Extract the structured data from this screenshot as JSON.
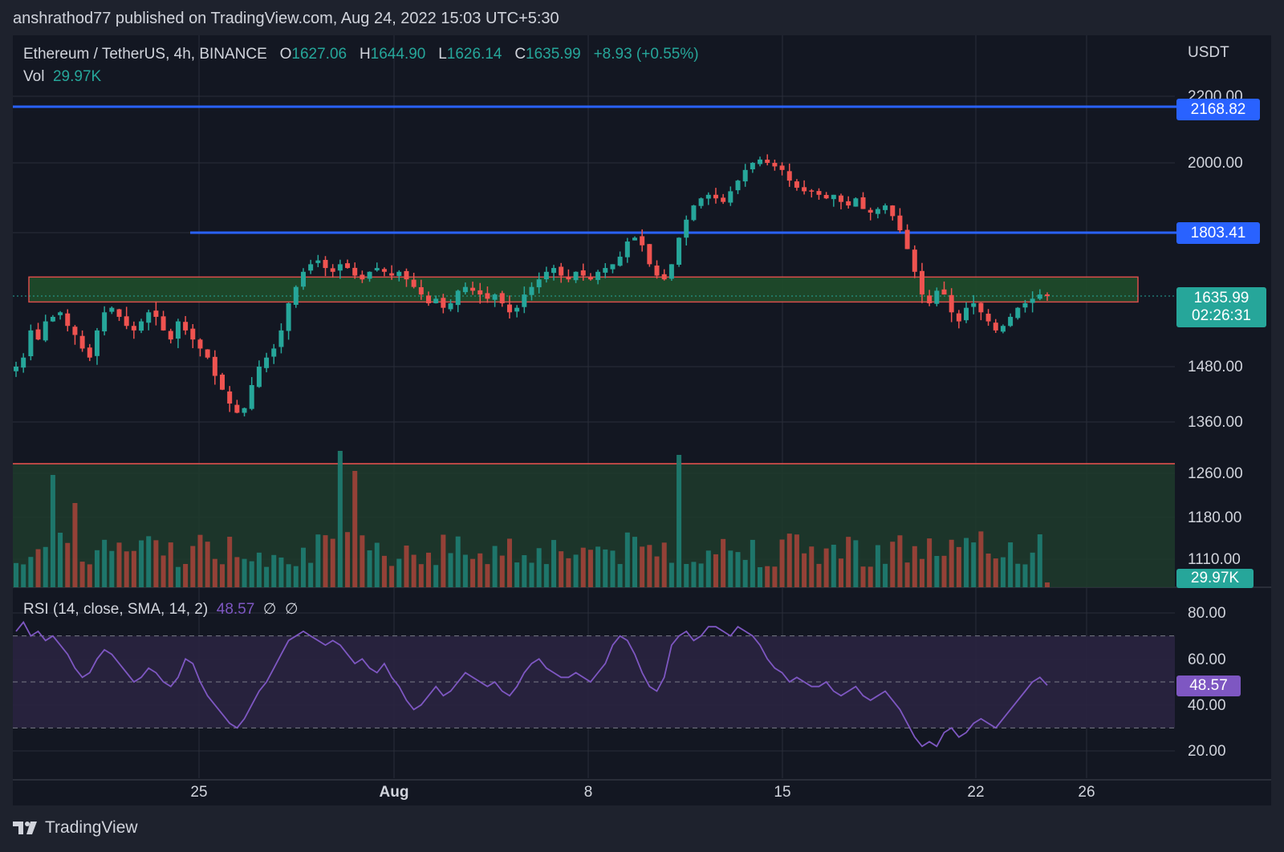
{
  "header": {
    "publish_line": "anshrathod77 published on TradingView.com, Aug 24, 2022 15:03 UTC+5:30"
  },
  "legend": {
    "symbol": "Ethereum / TetherUS, 4h, BINANCE",
    "o_label": "O",
    "o_value": "1627.06",
    "h_label": "H",
    "h_value": "1644.90",
    "l_label": "L",
    "l_value": "1626.14",
    "c_label": "C",
    "c_value": "1635.99",
    "change": "+8.93 (+0.55%)",
    "vol_label": "Vol",
    "vol_value": "29.97K"
  },
  "rsi_legend": {
    "label": "RSI (14, close, SMA, 14, 2)",
    "value": "48.57",
    "sym1": "∅",
    "sym2": "∅"
  },
  "price_axis": {
    "unit": "USDT",
    "ticks": [
      "2200.00",
      "2000.00",
      "1480.00",
      "1360.00",
      "1260.00",
      "1180.00",
      "1110.00"
    ]
  },
  "rsi_axis": {
    "ticks": [
      "80.00",
      "60.00",
      "40.00",
      "20.00"
    ]
  },
  "time_axis": {
    "ticks": [
      "25",
      "Aug",
      "8",
      "15",
      "22",
      "26"
    ]
  },
  "price_tags": {
    "resistance_high": "2168.82",
    "resistance_mid": "1803.41",
    "last_price": "1635.99",
    "countdown": "02:26:31",
    "volume": "29.97K",
    "rsi": "48.57"
  },
  "footer": {
    "brand": "TradingView"
  },
  "colors": {
    "up": "#26a69a",
    "down": "#ef5350",
    "line_blue": "#2962ff",
    "rsi_line": "#7e57c2",
    "background": "#131722"
  },
  "chart_data": {
    "type": "candlestick",
    "symbol": "ETH/USDT",
    "interval": "4h",
    "x_ticks": [
      "25",
      "Aug",
      "8",
      "15",
      "22",
      "26"
    ],
    "y_ticks": [
      2000,
      1480,
      1360,
      1260,
      1180,
      1110
    ],
    "horizontal_lines": [
      2168.82,
      1803.41
    ],
    "support_zone": [
      1630,
      1665
    ],
    "last_close": 1635.99,
    "close_series": [
      1480,
      1500,
      1560,
      1540,
      1580,
      1590,
      1600,
      1570,
      1550,
      1520,
      1500,
      1560,
      1600,
      1610,
      1590,
      1570,
      1560,
      1580,
      1600,
      1590,
      1560,
      1540,
      1580,
      1560,
      1540,
      1520,
      1500,
      1460,
      1430,
      1400,
      1380,
      1390,
      1440,
      1480,
      1500,
      1520,
      1560,
      1620,
      1660,
      1700,
      1720,
      1730,
      1710,
      1700,
      1720,
      1710,
      1690,
      1680,
      1700,
      1710,
      1700,
      1690,
      1700,
      1680,
      1660,
      1640,
      1620,
      1630,
      1610,
      1620,
      1650,
      1660,
      1650,
      1640,
      1630,
      1640,
      1620,
      1600,
      1610,
      1640,
      1660,
      1680,
      1700,
      1710,
      1690,
      1680,
      1700,
      1690,
      1680,
      1700,
      1710,
      1720,
      1740,
      1780,
      1790,
      1770,
      1720,
      1690,
      1680,
      1720,
      1790,
      1840,
      1880,
      1900,
      1910,
      1900,
      1890,
      1920,
      1950,
      1980,
      2000,
      2010,
      2000,
      1990,
      1980,
      1950,
      1930,
      1920,
      1920,
      1910,
      1900,
      1910,
      1890,
      1880,
      1900,
      1870,
      1860,
      1870,
      1880,
      1850,
      1810,
      1760,
      1700,
      1640,
      1620,
      1650,
      1640,
      1600,
      1580,
      1610,
      1620,
      1600,
      1580,
      1560,
      1570,
      1590,
      1610,
      1620,
      1630,
      1640,
      1636
    ],
    "volume_note": "relative volume bars, last 29.97K",
    "rsi": {
      "params": "RSI (14, close, SMA, 14, 2)",
      "last": 48.57,
      "bands": [
        30,
        50,
        70
      ],
      "y_ticks": [
        80,
        60,
        40,
        20
      ],
      "values": [
        72,
        76,
        70,
        72,
        68,
        70,
        66,
        62,
        56,
        52,
        54,
        60,
        64,
        62,
        58,
        54,
        50,
        52,
        56,
        54,
        50,
        48,
        52,
        60,
        58,
        50,
        44,
        40,
        36,
        32,
        30,
        34,
        40,
        46,
        50,
        56,
        62,
        68,
        70,
        72,
        70,
        68,
        66,
        68,
        66,
        62,
        58,
        60,
        56,
        54,
        58,
        52,
        48,
        42,
        38,
        40,
        44,
        48,
        44,
        46,
        50,
        54,
        52,
        50,
        48,
        50,
        46,
        44,
        48,
        54,
        58,
        60,
        56,
        54,
        52,
        52,
        54,
        52,
        50,
        54,
        58,
        66,
        70,
        68,
        62,
        54,
        48,
        46,
        52,
        66,
        70,
        72,
        68,
        70,
        74,
        74,
        72,
        70,
        74,
        72,
        70,
        66,
        60,
        56,
        54,
        50,
        52,
        50,
        48,
        48,
        50,
        46,
        44,
        46,
        48,
        44,
        42,
        44,
        46,
        42,
        38,
        32,
        26,
        22,
        24,
        22,
        28,
        30,
        26,
        28,
        32,
        34,
        32,
        30,
        34,
        38,
        42,
        46,
        50,
        52,
        48.57
      ]
    }
  }
}
